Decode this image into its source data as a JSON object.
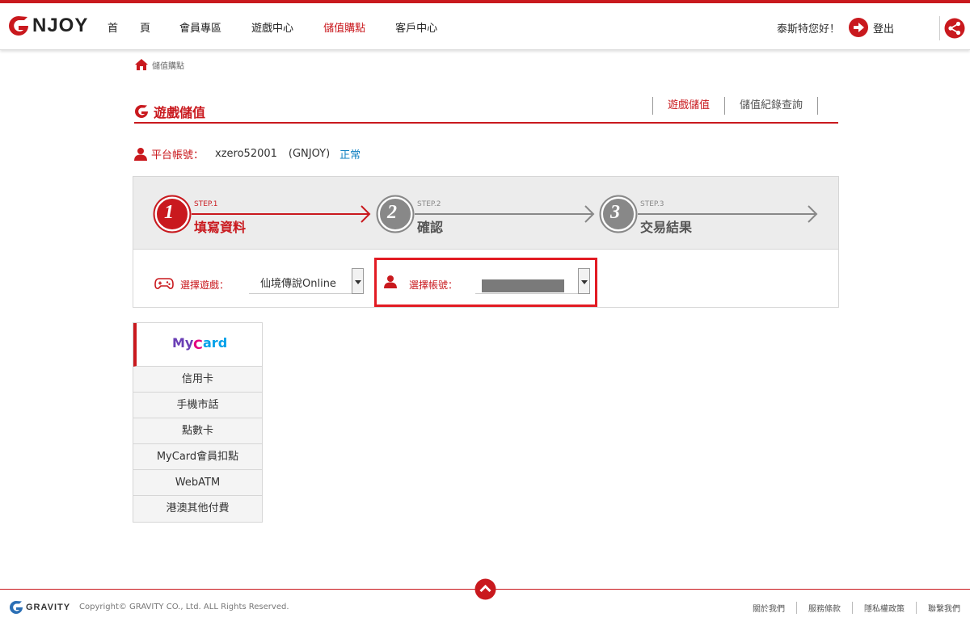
{
  "header": {
    "logo_text": "NJOY",
    "nav": [
      {
        "label": "首"
      },
      {
        "label": "頁"
      },
      {
        "label": "會員專區"
      },
      {
        "label": "遊戲中心"
      },
      {
        "label": "儲值購點"
      },
      {
        "label": "客戶中心"
      }
    ],
    "greeting": "泰斯特您好！",
    "logout_label": "登出"
  },
  "breadcrumb": {
    "label": "儲值購點"
  },
  "section": {
    "title": "遊戲儲值",
    "tabs": [
      {
        "label": "遊戲儲值"
      },
      {
        "label": "儲值紀錄查詢"
      }
    ]
  },
  "account": {
    "label": "平台帳號：",
    "id": "xzero52001",
    "platform": "(GNJOY)",
    "status": "正常"
  },
  "steps": [
    {
      "number": "1",
      "small": "STEP.1",
      "label": "填寫資料"
    },
    {
      "number": "2",
      "small": "STEP.2",
      "label": "確認"
    },
    {
      "number": "3",
      "small": "STEP.3",
      "label": "交易結果"
    }
  ],
  "form": {
    "game_label": "選擇遊戲：",
    "game_value": "仙境傳說Online",
    "account_label": "選擇帳號：",
    "account_value": ""
  },
  "payment": {
    "featured": "MyCard",
    "items": [
      {
        "label": "信用卡"
      },
      {
        "label": "手機市話"
      },
      {
        "label": "點數卡"
      },
      {
        "label": "MyCard會員扣點"
      },
      {
        "label": "WebATM"
      },
      {
        "label": "港澳其他付費"
      }
    ]
  },
  "footer": {
    "brand": "GRAVITY",
    "copyright": "Copyright© GRAVITY CO., Ltd. ALL Rights Reserved.",
    "links": [
      {
        "label": "關於我們"
      },
      {
        "label": "服務條款"
      },
      {
        "label": "隱私權政策"
      },
      {
        "label": "聯繫我們"
      }
    ]
  },
  "colors": {
    "brand_red": "#c9191e",
    "status_blue": "#0b7ec0"
  }
}
